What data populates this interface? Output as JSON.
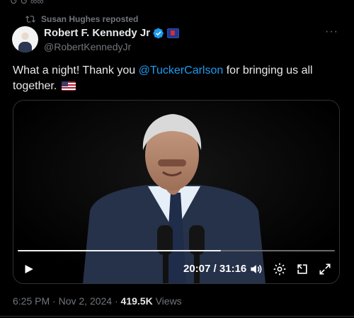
{
  "top_partial": "↺  ↺ ∞∞",
  "repost_label": "Susan Hughes reposted",
  "author": {
    "name": "Robert F. Kennedy Jr",
    "handle": "@RobertKennedyJr",
    "verified_icon": "verified-badge-icon",
    "affiliation_icon": "affiliation-badge-icon"
  },
  "more_label": "···",
  "tweet": {
    "text_before": "What a night! Thank you ",
    "mention": "@TuckerCarlson",
    "text_after": " for bringing us all together."
  },
  "video": {
    "progress": 0.64,
    "current_time": "20:07",
    "separator": " / ",
    "duration": "31:16"
  },
  "meta": {
    "time": "6:25 PM",
    "dot1": " · ",
    "date": "Nov 2, 2024",
    "dot2": " · ",
    "views_count": "419.5K",
    "views_label": " Views"
  },
  "colors": {
    "background": "#000000",
    "text": "#e7e9ea",
    "muted": "#71767b",
    "accent": "#1d9bf0",
    "border": "#2f3336"
  }
}
